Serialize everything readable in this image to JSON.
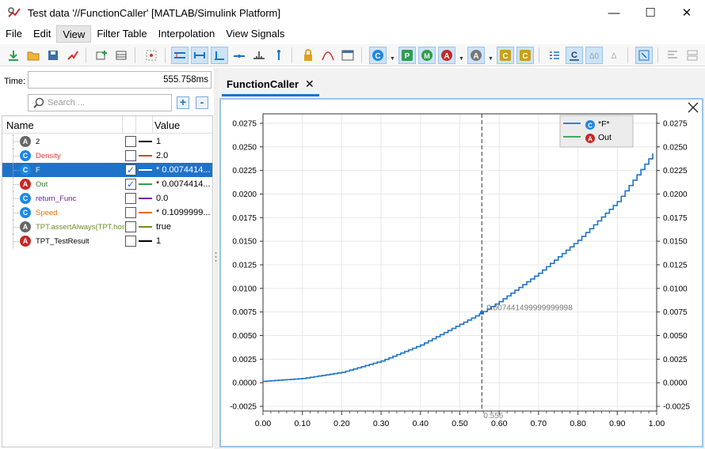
{
  "window": {
    "title": "Test data '//FunctionCaller' [MATLAB/Simulink Platform]",
    "minimize": "—",
    "maximize": "☐",
    "close": "✕"
  },
  "menu": [
    "File",
    "Edit",
    "View",
    "Filter Table",
    "Interpolation",
    "View Signals"
  ],
  "menu_active": "View",
  "left_panel": {
    "time_label": "Time:",
    "time_value": "555.758ms",
    "search_placeholder": "Search ...",
    "add_label": "+",
    "remove_label": "-",
    "col_name": "Name",
    "col_value": "Value",
    "signals": [
      {
        "name": "2",
        "icon": "A",
        "icon_color": "#666666",
        "name_color": "#000000",
        "checked": false,
        "line_color": "#000000",
        "value": "1",
        "selected": false
      },
      {
        "name": "Density",
        "icon": "C",
        "icon_color": "#1e88e5",
        "name_color": "#e53935",
        "checked": false,
        "line_color": "#e53935",
        "value": "2.0",
        "selected": false
      },
      {
        "name": "F",
        "icon": "C",
        "icon_color": "#1e88e5",
        "name_color": "#ffffff",
        "checked": true,
        "line_color": "#1e73c8",
        "value": "* 0.0074414...",
        "selected": true
      },
      {
        "name": "Out",
        "icon": "A",
        "icon_color": "#c62828",
        "name_color": "#2e7d32",
        "checked": true,
        "line_color": "#2e9e4f",
        "value": "* 0.0074414...",
        "selected": false
      },
      {
        "name": "return_Func",
        "icon": "C",
        "icon_color": "#1e88e5",
        "name_color": "#6a1b9a",
        "checked": false,
        "line_color": "#7b1fa2",
        "value": "0.0",
        "selected": false
      },
      {
        "name": "Speed",
        "icon": "C",
        "icon_color": "#1e88e5",
        "name_color": "#ef6c00",
        "checked": false,
        "line_color": "#ef6c00",
        "value": "* 0.1099999...",
        "selected": false
      },
      {
        "name": "TPT.assertAlways(TPT.hose",
        "icon": "A",
        "icon_color": "#666666",
        "name_color": "#6b8e23",
        "checked": false,
        "line_color": "#6b8e23",
        "value": "true",
        "selected": false
      },
      {
        "name": "TPT_TestResult",
        "icon": "A",
        "icon_color": "#c62828",
        "name_color": "#000000",
        "checked": false,
        "line_color": "#000000",
        "value": "1",
        "selected": false
      }
    ]
  },
  "tab": {
    "label": "FunctionCaller",
    "close": "✕"
  },
  "chart_data": {
    "type": "line",
    "title": "",
    "xlabel": "",
    "ylabel": "",
    "xlim": [
      0.0,
      1.0
    ],
    "ylim": [
      -0.003,
      0.0285
    ],
    "x_ticks": [
      "0.00",
      "0.10",
      "0.20",
      "0.30",
      "0.40",
      "0.50",
      "0.60",
      "0.70",
      "0.80",
      "0.90",
      "1.00"
    ],
    "y_ticks": [
      "-0.0025",
      "0.0000",
      "0.0025",
      "0.0050",
      "0.0075",
      "0.0100",
      "0.0125",
      "0.0150",
      "0.0175",
      "0.0200",
      "0.0225",
      "0.0250",
      "0.0275"
    ],
    "grid": true,
    "legend_position": "top-right",
    "series": [
      {
        "name": "*F*",
        "color": "#1e73c8",
        "style": "step",
        "x": [
          0.0,
          0.1,
          0.2,
          0.3,
          0.4,
          0.5,
          0.556,
          0.6,
          0.7,
          0.8,
          0.9,
          0.99
        ],
        "y": [
          0.00015,
          0.00045,
          0.0011,
          0.0023,
          0.004,
          0.0062,
          0.007441,
          0.0086,
          0.0116,
          0.0151,
          0.0192,
          0.0243
        ]
      },
      {
        "name": "Out",
        "color": "#2e9e4f",
        "style": "line",
        "x": [],
        "y": []
      }
    ],
    "cursor": {
      "x": 0.556,
      "x_label": "0.556",
      "value_label": "0.007441499999999998"
    }
  }
}
